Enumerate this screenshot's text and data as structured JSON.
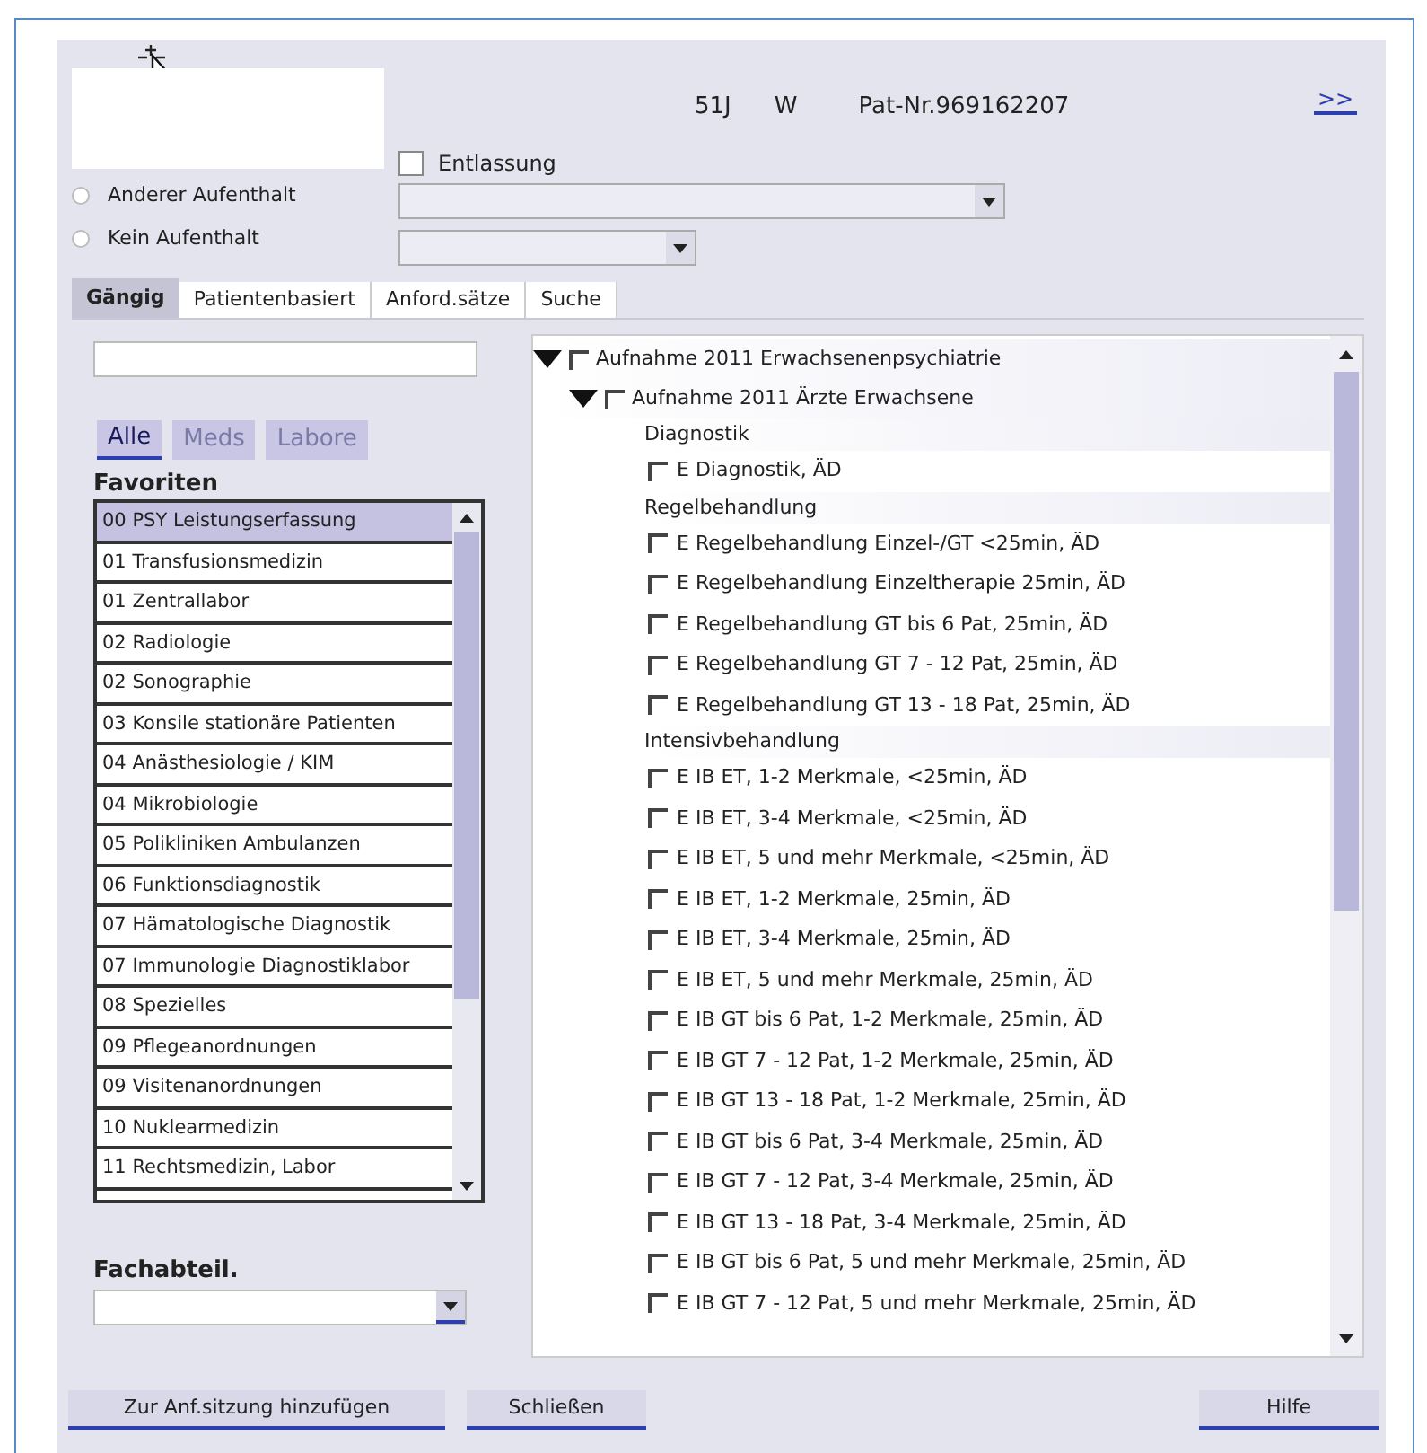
{
  "header": {
    "age": "51J",
    "sex": "W",
    "patient_number": "Pat-Nr.969162207",
    "expand_button": ">>"
  },
  "discharge": {
    "label": "Entlassung",
    "checked": false
  },
  "stay_options": [
    {
      "label": "Anderer Aufenthalt",
      "selected": false
    },
    {
      "label": "Kein Aufenthalt",
      "selected": false
    }
  ],
  "tabs": [
    {
      "label": "Gängig",
      "selected": true
    },
    {
      "label": "Patientenbasiert",
      "selected": false
    },
    {
      "label": "Anford.sätze",
      "selected": false
    },
    {
      "label": "Suche",
      "selected": false
    }
  ],
  "filter_buttons": [
    {
      "label": "Alle",
      "selected": true,
      "disabled": false
    },
    {
      "label": "Meds",
      "selected": false,
      "disabled": true
    },
    {
      "label": "Labore",
      "selected": false,
      "disabled": true
    }
  ],
  "favorites": {
    "title": "Favoriten",
    "items": [
      {
        "label": "00 PSY Leistungserfassung",
        "selected": true
      },
      {
        "label": "01 Transfusionsmedizin",
        "selected": false
      },
      {
        "label": "01 Zentrallabor",
        "selected": false
      },
      {
        "label": "02 Radiologie",
        "selected": false
      },
      {
        "label": "02 Sonographie",
        "selected": false
      },
      {
        "label": "03 Konsile stationäre Patienten",
        "selected": false
      },
      {
        "label": "04 Anästhesiologie / KIM",
        "selected": false
      },
      {
        "label": "04 Mikrobiologie",
        "selected": false
      },
      {
        "label": "05 Polikliniken Ambulanzen",
        "selected": false
      },
      {
        "label": "06 Funktionsdiagnostik",
        "selected": false
      },
      {
        "label": "07 Hämatologische Diagnostik",
        "selected": false
      },
      {
        "label": "07 Immunologie Diagnostiklabor",
        "selected": false
      },
      {
        "label": "08 Spezielles",
        "selected": false
      },
      {
        "label": "09 Pflegeanordnungen",
        "selected": false
      },
      {
        "label": "09 Visitenanordnungen",
        "selected": false
      },
      {
        "label": "10 Nuklearmedizin",
        "selected": false
      },
      {
        "label": "11 Rechtsmedizin, Labor",
        "selected": false
      }
    ]
  },
  "department": {
    "label": "Fachabteil."
  },
  "tree": [
    {
      "kind": "group",
      "label": "Aufnahme 2011 Erwachsenenpsychiatrie",
      "expanded": true,
      "checked": false,
      "children": [
        {
          "kind": "group",
          "label": "Aufnahme 2011 Ärzte Erwachsene",
          "expanded": true,
          "checked": false,
          "children": [
            {
              "kind": "section",
              "label": "Diagnostik"
            },
            {
              "kind": "item",
              "label": "E Diagnostik, ÄD",
              "checked": false
            },
            {
              "kind": "section",
              "label": "Regelbehandlung"
            },
            {
              "kind": "item",
              "label": "E Regelbehandlung Einzel-/GT <25min, ÄD",
              "checked": false
            },
            {
              "kind": "item",
              "label": "E Regelbehandlung Einzeltherapie 25min, ÄD",
              "checked": false
            },
            {
              "kind": "item",
              "label": "E Regelbehandlung GT bis 6 Pat, 25min, ÄD",
              "checked": false
            },
            {
              "kind": "item",
              "label": "E Regelbehandlung GT 7 - 12 Pat, 25min, ÄD",
              "checked": false
            },
            {
              "kind": "item",
              "label": "E Regelbehandlung GT 13 - 18 Pat, 25min, ÄD",
              "checked": false
            },
            {
              "kind": "section",
              "label": "Intensivbehandlung"
            },
            {
              "kind": "item",
              "label": "E IB ET, 1-2 Merkmale, <25min, ÄD",
              "checked": false
            },
            {
              "kind": "item",
              "label": "E IB ET, 3-4 Merkmale, <25min, ÄD",
              "checked": false
            },
            {
              "kind": "item",
              "label": "E IB ET, 5 und mehr Merkmale, <25min, ÄD",
              "checked": false
            },
            {
              "kind": "item",
              "label": "E IB ET, 1-2 Merkmale, 25min, ÄD",
              "checked": false
            },
            {
              "kind": "item",
              "label": "E IB ET, 3-4 Merkmale, 25min, ÄD",
              "checked": false
            },
            {
              "kind": "item",
              "label": "E IB ET, 5 und mehr Merkmale, 25min, ÄD",
              "checked": false
            },
            {
              "kind": "item",
              "label": "E IB GT bis 6 Pat, 1-2 Merkmale, 25min, ÄD",
              "checked": false
            },
            {
              "kind": "item",
              "label": "E IB GT 7 - 12 Pat, 1-2 Merkmale, 25min, ÄD",
              "checked": false
            },
            {
              "kind": "item",
              "label": "E IB GT 13 - 18 Pat, 1-2 Merkmale, 25min, ÄD",
              "checked": false
            },
            {
              "kind": "item",
              "label": "E IB GT bis 6 Pat, 3-4 Merkmale, 25min, ÄD",
              "checked": false
            },
            {
              "kind": "item",
              "label": "E IB GT 7 - 12 Pat, 3-4 Merkmale, 25min, ÄD",
              "checked": false
            },
            {
              "kind": "item",
              "label": "E IB GT 13 - 18 Pat, 3-4 Merkmale, 25min, ÄD",
              "checked": false
            },
            {
              "kind": "item",
              "label": "E IB GT bis 6 Pat, 5 und mehr Merkmale, 25min, ÄD",
              "checked": false
            },
            {
              "kind": "item",
              "label": "E IB GT 7 - 12 Pat, 5 und mehr Merkmale, 25min, ÄD",
              "checked": false
            }
          ]
        }
      ]
    }
  ],
  "footer_buttons": [
    "Zur Anf.sitzung hinzufügen",
    "Schließen",
    "Hilfe"
  ]
}
